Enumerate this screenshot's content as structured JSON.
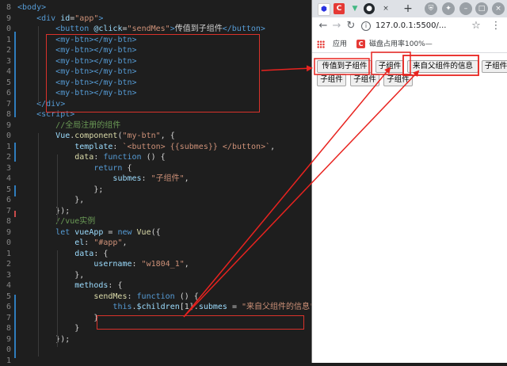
{
  "editor": {
    "line_numbers": [
      "8",
      "9",
      "0",
      "1",
      "2",
      "3",
      "4",
      "5",
      "6",
      "7",
      "8",
      "9",
      "0",
      "1",
      "2",
      "3",
      "4",
      "5",
      "6",
      "7",
      "8",
      "9",
      "0",
      "1",
      "2",
      "3",
      "4",
      "5",
      "6",
      "7",
      "8",
      "9",
      "0",
      "1"
    ],
    "lines": [
      [
        {
          "t": "<body>",
          "c": "tag"
        }
      ],
      [
        {
          "t": "    "
        },
        {
          "t": "<div",
          "c": "tag"
        },
        {
          "t": " id",
          "c": "attr"
        },
        {
          "t": "=",
          "c": "plain"
        },
        {
          "t": "\"app\"",
          "c": "str"
        },
        {
          "t": ">",
          "c": "tag"
        }
      ],
      [
        {
          "t": "        "
        },
        {
          "t": "<button",
          "c": "tag"
        },
        {
          "t": " @click",
          "c": "attr"
        },
        {
          "t": "=",
          "c": "plain"
        },
        {
          "t": "\"sendMes\"",
          "c": "str"
        },
        {
          "t": ">",
          "c": "tag"
        },
        {
          "t": "传值到子组件",
          "c": "plain"
        },
        {
          "t": "</button>",
          "c": "tag"
        }
      ],
      [
        {
          "t": "        "
        },
        {
          "t": "<my-btn></my-btn>",
          "c": "tag"
        }
      ],
      [
        {
          "t": "        "
        },
        {
          "t": "<my-btn></my-btn>",
          "c": "tag"
        }
      ],
      [
        {
          "t": "        "
        },
        {
          "t": "<my-btn></my-btn>",
          "c": "tag"
        }
      ],
      [
        {
          "t": "        "
        },
        {
          "t": "<my-btn></my-btn>",
          "c": "tag"
        }
      ],
      [
        {
          "t": "        "
        },
        {
          "t": "<my-btn></my-btn>",
          "c": "tag"
        }
      ],
      [
        {
          "t": "        "
        },
        {
          "t": "<my-btn></my-btn>",
          "c": "tag"
        }
      ],
      [
        {
          "t": "    "
        },
        {
          "t": "</div>",
          "c": "tag"
        }
      ],
      [
        {
          "t": "    "
        },
        {
          "t": "<script>",
          "c": "tag"
        }
      ],
      [
        {
          "t": "        "
        },
        {
          "t": "//全局注册的组件",
          "c": "com"
        }
      ],
      [
        {
          "t": "        "
        },
        {
          "t": "Vue",
          "c": "var"
        },
        {
          "t": ".",
          "c": "plain"
        },
        {
          "t": "component",
          "c": "fn"
        },
        {
          "t": "(",
          "c": "plain"
        },
        {
          "t": "\"my-btn\"",
          "c": "str"
        },
        {
          "t": ", {",
          "c": "plain"
        }
      ],
      [
        {
          "t": "            "
        },
        {
          "t": "template",
          "c": "var"
        },
        {
          "t": ": ",
          "c": "plain"
        },
        {
          "t": "`<button> {{submes}} </button>`",
          "c": "str"
        },
        {
          "t": ",",
          "c": "plain"
        }
      ],
      [
        {
          "t": "            "
        },
        {
          "t": "data",
          "c": "fn"
        },
        {
          "t": ": ",
          "c": "plain"
        },
        {
          "t": "function",
          "c": "kw"
        },
        {
          "t": " () {",
          "c": "plain"
        }
      ],
      [
        {
          "t": "                "
        },
        {
          "t": "return",
          "c": "kw"
        },
        {
          "t": " {",
          "c": "plain"
        }
      ],
      [
        {
          "t": "                    "
        },
        {
          "t": "submes",
          "c": "var"
        },
        {
          "t": ": ",
          "c": "plain"
        },
        {
          "t": "\"子组件\"",
          "c": "str"
        },
        {
          "t": ",",
          "c": "plain"
        }
      ],
      [
        {
          "t": "                "
        },
        {
          "t": "};",
          "c": "plain"
        }
      ],
      [
        {
          "t": "            "
        },
        {
          "t": "},",
          "c": "plain"
        }
      ],
      [
        {
          "t": "        "
        },
        {
          "t": "});",
          "c": "plain"
        }
      ],
      [
        {
          "t": "        "
        },
        {
          "t": "//vue实例",
          "c": "com"
        }
      ],
      [
        {
          "t": "        "
        },
        {
          "t": "let",
          "c": "kw"
        },
        {
          "t": " vueApp",
          "c": "var"
        },
        {
          "t": " = ",
          "c": "plain"
        },
        {
          "t": "new",
          "c": "kw"
        },
        {
          "t": " Vue",
          "c": "fn"
        },
        {
          "t": "({",
          "c": "plain"
        }
      ],
      [
        {
          "t": "            "
        },
        {
          "t": "el",
          "c": "var"
        },
        {
          "t": ": ",
          "c": "plain"
        },
        {
          "t": "\"#app\"",
          "c": "str"
        },
        {
          "t": ",",
          "c": "plain"
        }
      ],
      [
        {
          "t": "            "
        },
        {
          "t": "data",
          "c": "var"
        },
        {
          "t": ": {",
          "c": "plain"
        }
      ],
      [
        {
          "t": "                "
        },
        {
          "t": "username",
          "c": "var"
        },
        {
          "t": ": ",
          "c": "plain"
        },
        {
          "t": "\"w1804_1\"",
          "c": "str"
        },
        {
          "t": ",",
          "c": "plain"
        }
      ],
      [
        {
          "t": "            "
        },
        {
          "t": "},",
          "c": "plain"
        }
      ],
      [
        {
          "t": "            "
        },
        {
          "t": "methods",
          "c": "var"
        },
        {
          "t": ": {",
          "c": "plain"
        }
      ],
      [
        {
          "t": "                "
        },
        {
          "t": "sendMes",
          "c": "fn"
        },
        {
          "t": ": ",
          "c": "plain"
        },
        {
          "t": "function",
          "c": "kw"
        },
        {
          "t": " () {",
          "c": "plain"
        }
      ],
      [
        {
          "t": "                    "
        },
        {
          "t": "this",
          "c": "kw"
        },
        {
          "t": ".",
          "c": "plain"
        },
        {
          "t": "$children",
          "c": "var"
        },
        {
          "t": "[1].",
          "c": "plain"
        },
        {
          "t": "submes",
          "c": "var"
        },
        {
          "t": " = ",
          "c": "plain"
        },
        {
          "t": "\"来自父组件的信息\"",
          "c": "str"
        },
        {
          "t": ";",
          "c": "plain"
        }
      ],
      [
        {
          "t": "                "
        },
        {
          "t": "}",
          "c": "plain"
        }
      ],
      [
        {
          "t": "            "
        },
        {
          "t": "}",
          "c": "plain"
        }
      ],
      [
        {
          "t": "        "
        },
        {
          "t": "});",
          "c": "plain"
        }
      ],
      [
        {
          "t": ""
        }
      ],
      [
        {
          "t": ""
        }
      ]
    ]
  },
  "browser": {
    "url": "127.0.0.1:5500/...",
    "bookmarks": {
      "apps_label": "应用",
      "bookmark_label": "磁盘占用率100%—"
    },
    "page_buttons": {
      "send": "传值到子组件",
      "child1": "子组件",
      "child2_updated": "来自父组件的信息",
      "child3": "子组件",
      "child4": "子组件",
      "child5": "子组件",
      "child6": "子组件"
    }
  },
  "annotation_color": "#e8231f",
  "syntax_colors": {
    "tag": "#569cd6",
    "attr": "#9cdcfe",
    "str": "#ce9178",
    "com": "#6a9955",
    "kw": "#569cd6",
    "fn": "#dcdcaa",
    "var": "#9cdcfe",
    "plain": "#d4d4d4"
  }
}
